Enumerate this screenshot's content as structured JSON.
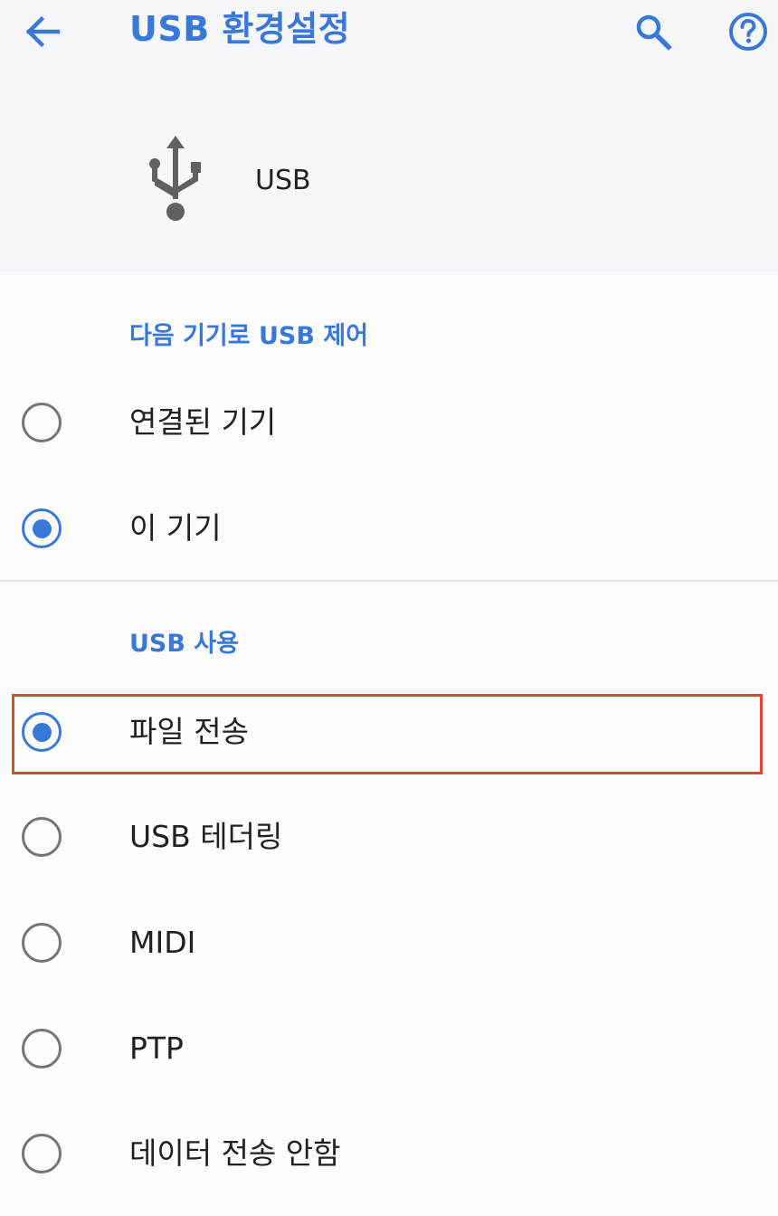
{
  "header": {
    "title": "USB 환경설정",
    "back_icon": "arrow-back-icon",
    "search_icon": "search-icon",
    "help_icon": "help-circle-icon"
  },
  "device": {
    "icon": "usb-icon",
    "label": "USB"
  },
  "usb_control": {
    "header": "다음 기기로 USB 제어",
    "options": [
      {
        "label": "연결된 기기",
        "checked": false
      },
      {
        "label": "이 기기",
        "checked": true
      }
    ]
  },
  "usb_use": {
    "header": "USB 사용",
    "options": [
      {
        "label": "파일 전송",
        "checked": true
      },
      {
        "label": "USB 테더링",
        "checked": false
      },
      {
        "label": "MIDI",
        "checked": false
      },
      {
        "label": "PTP",
        "checked": false
      },
      {
        "label": "데이터 전송 안함",
        "checked": false
      }
    ]
  },
  "colors": {
    "accent": "#3a78d8",
    "highlight": "#e0452f"
  }
}
